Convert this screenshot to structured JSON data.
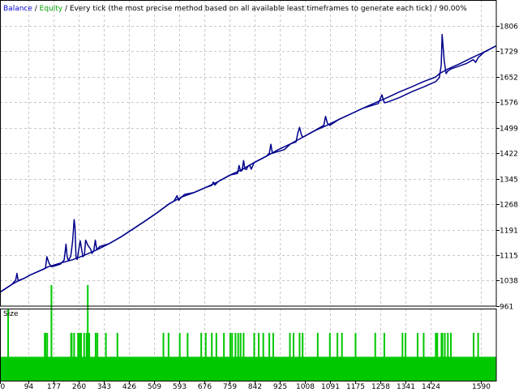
{
  "header": {
    "balance": "Balance",
    "sep1": " / ",
    "equity": "Equity",
    "rest": " / Every tick (the most precise method based on all available least timeframes to generate each tick) / 90.00%"
  },
  "colors": {
    "balance": "#0000cc",
    "equity_label": "#00a000",
    "line": "#00008b",
    "size_bar": "#00c800",
    "grid": "#c8c8c8",
    "axis": "#000000"
  },
  "chart_data": [
    {
      "type": "line",
      "title": "",
      "ylim": [
        961,
        1840
      ],
      "xlim": [
        0,
        1640
      ],
      "y_ticks": [
        961,
        1038,
        1115,
        1191,
        1268,
        1345,
        1422,
        1499,
        1576,
        1652,
        1729,
        1806
      ],
      "x_ticks": [
        0,
        94,
        177,
        260,
        343,
        426,
        509,
        593,
        676,
        759,
        842,
        925,
        1008,
        1091,
        1175,
        1258,
        1341,
        1424,
        1590
      ],
      "grid": true,
      "series": [
        {
          "name": "Balance",
          "x": [
            0,
            20,
            40,
            60,
            80,
            100,
            120,
            140,
            160,
            200,
            240,
            280,
            320,
            360,
            400,
            440,
            480,
            520,
            560,
            600,
            640,
            680,
            720,
            760,
            800,
            840,
            880,
            920,
            960,
            1000,
            1040,
            1080,
            1120,
            1160,
            1200,
            1240,
            1280,
            1320,
            1360,
            1400,
            1440,
            1452,
            1480,
            1520,
            1560,
            1600,
            1640
          ],
          "values": [
            1003,
            1015,
            1027,
            1037,
            1045,
            1055,
            1063,
            1071,
            1080,
            1091,
            1101,
            1115,
            1131,
            1149,
            1170,
            1194,
            1218,
            1243,
            1270,
            1290,
            1303,
            1319,
            1336,
            1356,
            1373,
            1394,
            1413,
            1433,
            1450,
            1470,
            1490,
            1506,
            1524,
            1541,
            1558,
            1574,
            1590,
            1607,
            1622,
            1638,
            1652,
            1662,
            1676,
            1692,
            1710,
            1727,
            1746
          ]
        },
        {
          "name": "Equity",
          "x": [
            0,
            20,
            40,
            52,
            56,
            60,
            80,
            100,
            140,
            150,
            155,
            162,
            170,
            180,
            200,
            212,
            218,
            222,
            226,
            234,
            240,
            245,
            248,
            251,
            255,
            265,
            268,
            274,
            279,
            283,
            290,
            300,
            304,
            310,
            315,
            320,
            330,
            360,
            400,
            440,
            480,
            520,
            560,
            575,
            585,
            590,
            600,
            610,
            640,
            680,
            700,
            705,
            710,
            720,
            760,
            785,
            790,
            795,
            800,
            805,
            809,
            814,
            820,
            825,
            830,
            840,
            880,
            890,
            895,
            900,
            940,
            960,
            978,
            984,
            990,
            996,
            1000,
            1040,
            1070,
            1076,
            1082,
            1090,
            1120,
            1160,
            1200,
            1250,
            1262,
            1270,
            1280,
            1320,
            1360,
            1400,
            1440,
            1452,
            1458,
            1461,
            1468,
            1474,
            1480,
            1490,
            1540,
            1564,
            1568,
            1572,
            1580,
            1600,
            1640
          ],
          "values": [
            1003,
            1015,
            1027,
            1040,
            1060,
            1038,
            1045,
            1055,
            1071,
            1075,
            1110,
            1090,
            1080,
            1082,
            1088,
            1100,
            1148,
            1110,
            1098,
            1112,
            1158,
            1222,
            1200,
            1110,
            1102,
            1158,
            1142,
            1110,
            1116,
            1160,
            1145,
            1132,
            1120,
            1128,
            1160,
            1131,
            1141,
            1149,
            1170,
            1194,
            1218,
            1243,
            1270,
            1278,
            1294,
            1280,
            1290,
            1298,
            1303,
            1319,
            1325,
            1335,
            1326,
            1336,
            1356,
            1361,
            1385,
            1368,
            1370,
            1400,
            1375,
            1373,
            1383,
            1386,
            1374,
            1394,
            1413,
            1422,
            1449,
            1422,
            1433,
            1450,
            1456,
            1482,
            1500,
            1478,
            1470,
            1490,
            1506,
            1533,
            1512,
            1506,
            1524,
            1541,
            1558,
            1572,
            1598,
            1574,
            1576,
            1590,
            1607,
            1622,
            1638,
            1650,
            1688,
            1780,
            1700,
            1662,
            1670,
            1676,
            1692,
            1704,
            1700,
            1696,
            1710,
            1727,
            1746
          ]
        }
      ]
    },
    {
      "type": "bar",
      "title": "Size",
      "ylim": [
        0,
        2
      ],
      "series": [
        {
          "name": "Size",
          "baseline": 1,
          "x": [
            27,
            148,
            150,
            156,
            170,
            235,
            237,
            245,
            258,
            263,
            268,
            278,
            286,
            290,
            295,
            316,
            322,
            350,
            388,
            540,
            557,
            594,
            620,
            665,
            680,
            700,
            715,
            740,
            761,
            767,
            778,
            787,
            795,
            805,
            840,
            855,
            870,
            890,
            903,
            958,
            970,
            990,
            1000,
            1050,
            1090,
            1115,
            1130,
            1175,
            1240,
            1270,
            1330,
            1340,
            1380,
            1400,
            1440,
            1445,
            1459,
            1460,
            1462,
            1470,
            1480,
            1490,
            1565,
            1580
          ],
          "values": [
            2,
            1,
            1,
            1,
            3,
            1,
            1,
            1,
            1,
            1,
            1,
            1,
            1,
            3,
            1,
            1,
            1,
            1,
            1,
            1,
            1,
            1,
            1,
            1,
            1,
            1,
            1,
            1,
            1,
            1,
            1,
            1,
            1,
            1,
            1,
            1,
            1,
            1,
            1,
            1,
            1,
            1,
            1,
            1,
            1,
            1,
            1,
            1,
            1,
            1,
            1,
            1,
            1,
            1,
            1,
            1,
            1,
            1,
            1,
            1,
            1,
            1,
            1,
            1
          ]
        }
      ]
    }
  ]
}
